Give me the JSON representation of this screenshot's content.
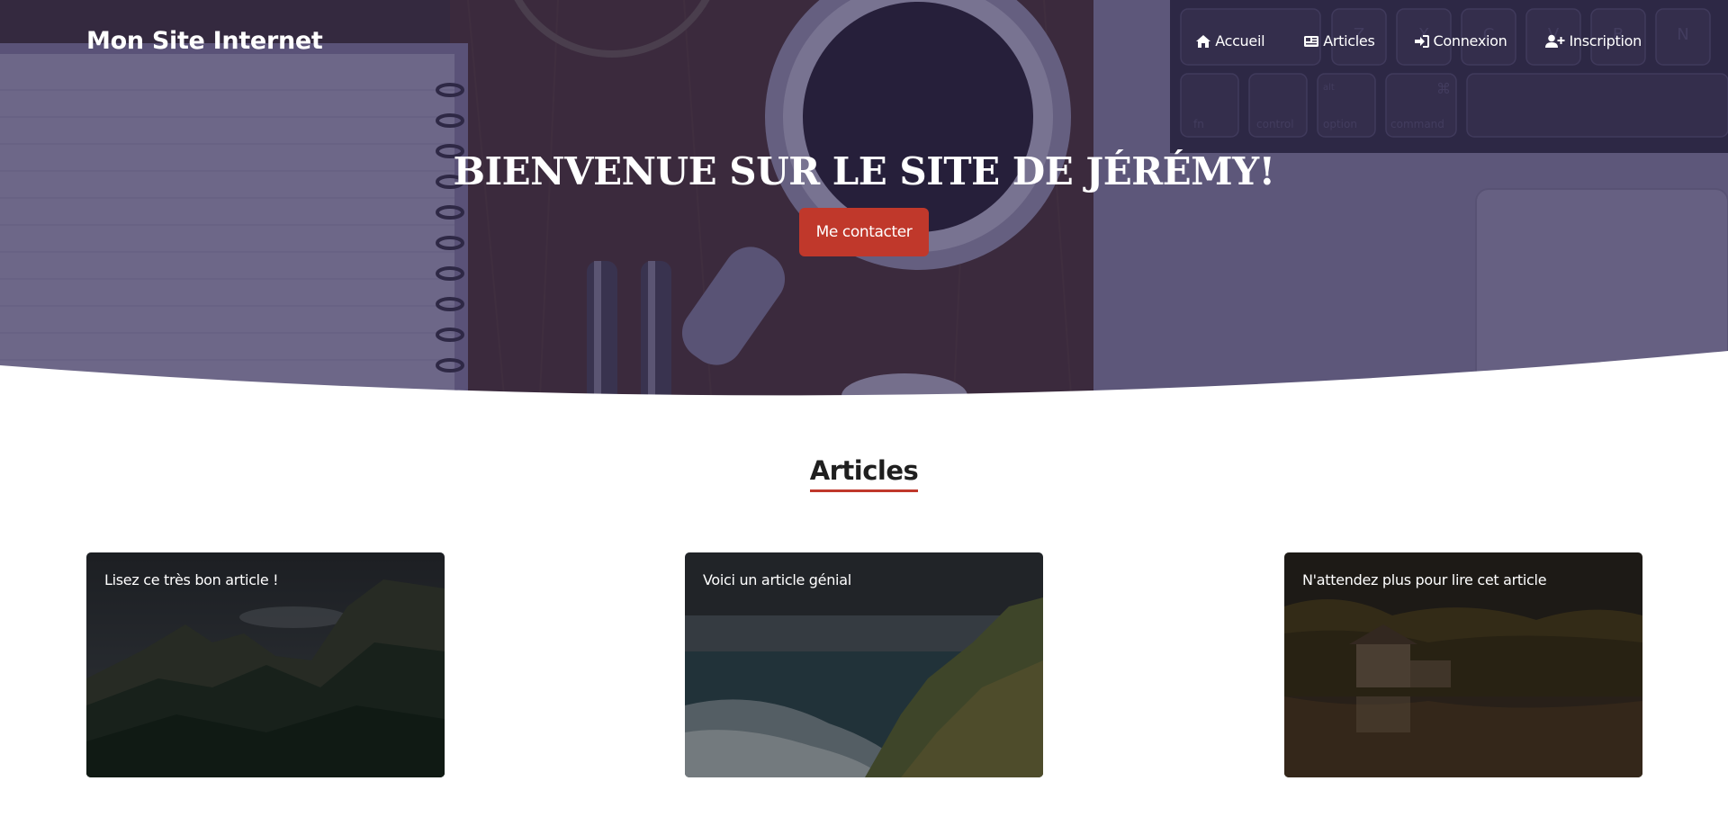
{
  "header": {
    "brand": "Mon Site Internet",
    "nav": [
      {
        "label": "Accueil",
        "icon": "home-icon"
      },
      {
        "label": "Articles",
        "icon": "newspaper-icon"
      },
      {
        "label": "Connexion",
        "icon": "sign-in-icon"
      },
      {
        "label": "Inscription",
        "icon": "user-plus-icon"
      }
    ]
  },
  "hero": {
    "title": "BIENVENUE SUR LE SITE DE JÉRÉMY!",
    "button_label": "Me contacter",
    "laptop_keys": [
      "Z",
      "X",
      "C",
      "V",
      "B",
      "N",
      "fn",
      "control",
      "alt",
      "option",
      "⌘",
      "command"
    ]
  },
  "articles": {
    "heading": "Articles",
    "items": [
      {
        "title": "Lisez ce très bon article !"
      },
      {
        "title": "Voici un article génial"
      },
      {
        "title": "N'attendez plus pour lire cet article"
      }
    ]
  },
  "colors": {
    "accent": "#c0382b",
    "hero_overlay": "#302850",
    "text_dark": "#1f1f1f",
    "white": "#ffffff"
  }
}
